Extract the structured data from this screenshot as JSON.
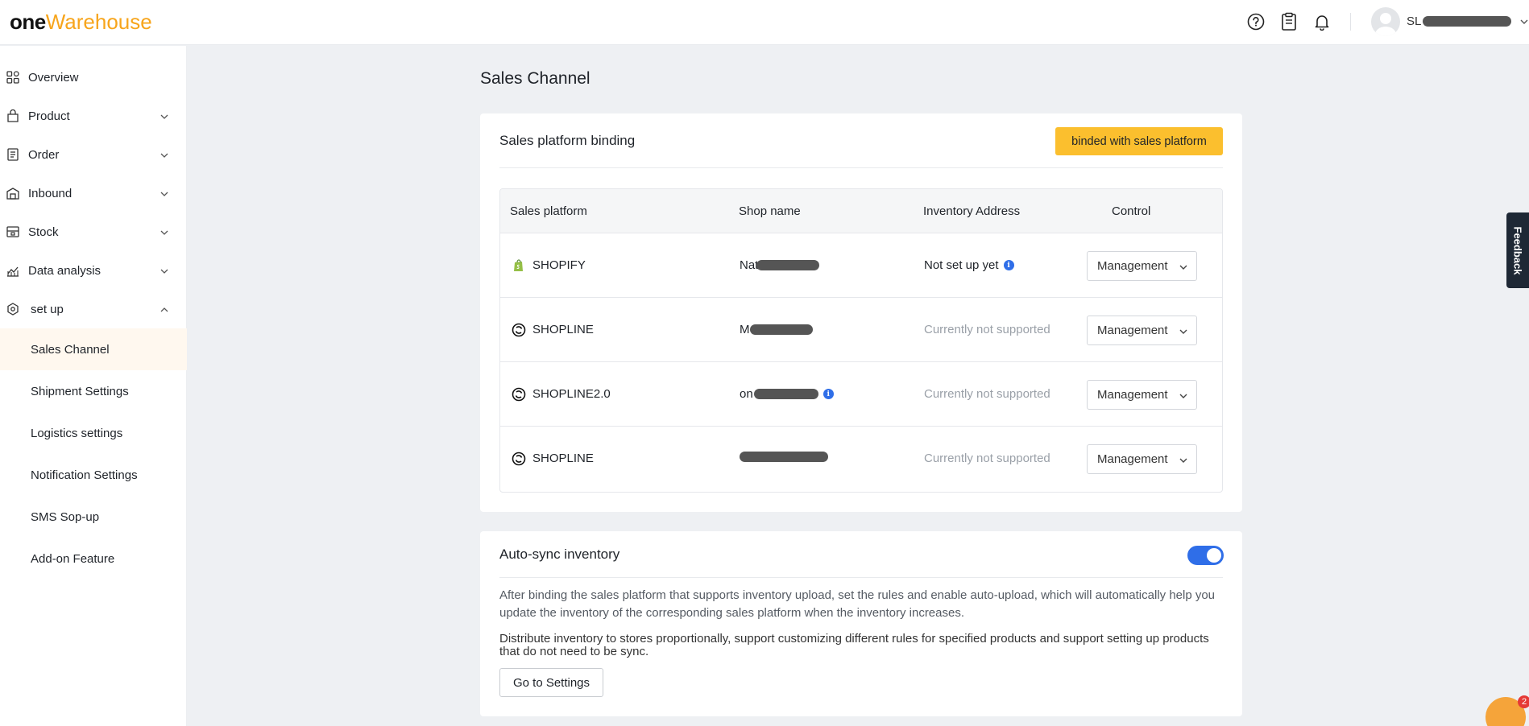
{
  "header": {
    "logo_one": "one",
    "logo_warehouse": "Warehouse",
    "user_name_prefix": "SL"
  },
  "sidebar": {
    "items": [
      {
        "label": "Overview",
        "icon": "grid-icon"
      },
      {
        "label": "Product",
        "icon": "product-icon"
      },
      {
        "label": "Order",
        "icon": "order-icon"
      },
      {
        "label": "Inbound",
        "icon": "inbound-icon"
      },
      {
        "label": "Stock",
        "icon": "stock-icon"
      },
      {
        "label": "Data analysis",
        "icon": "chart-icon"
      },
      {
        "label": "set up",
        "icon": "settings-hex-icon"
      }
    ],
    "subitems": [
      {
        "label": "Sales Channel",
        "active": true
      },
      {
        "label": "Shipment Settings"
      },
      {
        "label": "Logistics settings"
      },
      {
        "label": "Notification Settings"
      },
      {
        "label": "SMS Sop-up"
      },
      {
        "label": "Add-on Feature"
      }
    ]
  },
  "page": {
    "title": "Sales Channel"
  },
  "binding": {
    "title": "Sales platform binding",
    "button": "binded with sales platform",
    "columns": [
      "Sales platform",
      "Shop name",
      "Inventory Address",
      "Control"
    ],
    "rows": [
      {
        "platform": "SHOPIFY",
        "shop_visible": "Nat",
        "inventory": "Not set up yet",
        "control": "Management"
      },
      {
        "platform": "SHOPLINE",
        "shop_visible": "M",
        "inventory": "Currently not supported",
        "control": "Management"
      },
      {
        "platform": "SHOPLINE2.0",
        "shop_visible": "on",
        "inventory": "Currently not supported",
        "control": "Management"
      },
      {
        "platform": "SHOPLINE",
        "shop_visible": "",
        "inventory": "Currently not supported",
        "control": "Management"
      }
    ]
  },
  "autosync": {
    "title": "Auto-sync inventory",
    "enabled": true,
    "desc1": "After binding the sales platform that supports inventory upload, set the rules and enable auto-upload, which will automatically help you update the inventory of the corresponding sales platform when the inventory increases.",
    "desc2": "Distribute inventory to stores proportionally, support customizing different rules for specified products and support setting up products that do not need to be sync.",
    "button": "Go to Settings"
  },
  "widgets": {
    "feedback": "Feedback",
    "chat_badge": "2"
  },
  "colors": {
    "accent_yellow": "#fbbf2e",
    "logo_orange": "#f7a51c",
    "toggle_blue": "#2f6ee8",
    "active_bg": "#fff8ef"
  }
}
